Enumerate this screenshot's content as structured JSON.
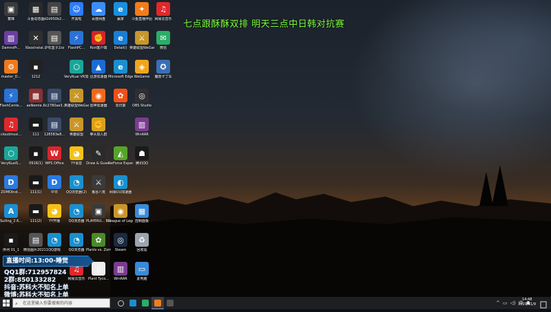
{
  "overlay_title": "七点跟酥酥双排 明天三点中日韩对抗赛",
  "icons": [
    {
      "label": "蓄降",
      "color": "#3a3a3a",
      "glyph": "▣",
      "col": 0,
      "row": 0
    },
    {
      "label": "斗鱼动态图",
      "color": "#2a2a2a",
      "glyph": "▦",
      "col": 1,
      "row": 0
    },
    {
      "label": "d2d950b2...",
      "color": "#444444",
      "glyph": "▤",
      "col": 2,
      "row": 0
    },
    {
      "label": "开黑啦",
      "color": "#2e7cf6",
      "glyph": "☺",
      "col": 3,
      "row": 0
    },
    {
      "label": "百度网盘",
      "color": "#3d8df5",
      "glyph": "☁",
      "col": 4,
      "row": 0
    },
    {
      "label": "赢家",
      "color": "#1a8fe0",
      "glyph": "e",
      "col": 5,
      "row": 0
    },
    {
      "label": "斗鱼直播伴侣",
      "color": "#f07d1a",
      "glyph": "✦",
      "col": 6,
      "row": 0
    },
    {
      "label": "网易云音乐",
      "color": "#e0282b",
      "glyph": "♫",
      "col": 7,
      "row": 0
    },
    {
      "label": "DamnsPr...",
      "color": "#6b3fa0",
      "glyph": "▥",
      "col": 0,
      "row": 1
    },
    {
      "label": "XboxInstal...",
      "color": "#2f2f2f",
      "glyph": "✕",
      "col": 1,
      "row": 1
    },
    {
      "label": "炉石盒子2zz",
      "color": "#555555",
      "glyph": "▤",
      "col": 2,
      "row": 1
    },
    {
      "label": "FlashPC...",
      "color": "#2a72d6",
      "glyph": "⚡",
      "col": 3,
      "row": 1
    },
    {
      "label": "Riot客户端",
      "color": "#d5242a",
      "glyph": "✊",
      "col": 4,
      "row": 1
    },
    {
      "label": "Detail()",
      "color": "#1a7fd4",
      "glyph": "e",
      "col": 5,
      "row": 1
    },
    {
      "label": "英雄联盟WeGame版",
      "color": "#c8962a",
      "glyph": "⚔",
      "col": 6,
      "row": 1
    },
    {
      "label": "微信",
      "color": "#2aae67",
      "glyph": "✉",
      "col": 7,
      "row": 1
    },
    {
      "label": "master_D...",
      "color": "#ee7a1c",
      "glyph": "⚙",
      "col": 0,
      "row": 2
    },
    {
      "label": "1212",
      "color": "#222222",
      "glyph": "▪",
      "col": 1,
      "row": 2
    },
    {
      "label": "VeryKuai VR加速器",
      "color": "#1aa69a",
      "glyph": "⬡",
      "col": 3,
      "row": 2
    },
    {
      "label": "迅游加速器",
      "color": "#1c6bd6",
      "glyph": "▲",
      "col": 4,
      "row": 2
    },
    {
      "label": "Microsoft Edge",
      "color": "#1b8fce",
      "glyph": "e",
      "col": 5,
      "row": 2
    },
    {
      "label": "WeGame",
      "color": "#f0a51f",
      "glyph": "◈",
      "col": 6,
      "row": 2
    },
    {
      "label": "魔兽卡丁车",
      "color": "#3b6fb5",
      "glyph": "✪",
      "col": 7,
      "row": 2
    },
    {
      "label": "FlashCente...",
      "color": "#2a72d6",
      "glyph": "⚡",
      "col": 0,
      "row": 3
    },
    {
      "label": "aeNemie...",
      "color": "#8a3030",
      "glyph": "▩",
      "col": 1,
      "row": 3
    },
    {
      "label": "6c2780ae3...",
      "color": "#3a4a6a",
      "glyph": "▤",
      "col": 2,
      "row": 3
    },
    {
      "label": "英雄联盟WeGame版",
      "color": "#c8962a",
      "glyph": "⚔",
      "col": 3,
      "row": 3
    },
    {
      "label": "雷神加速器",
      "color": "#f0681a",
      "glyph": "◉",
      "col": 4,
      "row": 3
    },
    {
      "label": "向日葵",
      "color": "#f0501a",
      "glyph": "✿",
      "col": 5,
      "row": 3
    },
    {
      "label": "OBS Studio",
      "color": "#302e31",
      "glyph": "◎",
      "col": 6,
      "row": 3
    },
    {
      "label": "cloudmusi...",
      "color": "#e0282b",
      "glyph": "♫",
      "col": 0,
      "row": 4
    },
    {
      "label": "111",
      "color": "#1a1a1a",
      "glyph": "▬",
      "col": 1,
      "row": 4
    },
    {
      "label": "128583e8...",
      "color": "#3a4a6a",
      "glyph": "▤",
      "col": 2,
      "row": 4
    },
    {
      "label": "英雄联盟",
      "color": "#c8962a",
      "glyph": "⚔",
      "col": 3,
      "row": 4
    },
    {
      "label": "拳头加入群",
      "color": "#d8a020",
      "glyph": "✊",
      "col": 4,
      "row": 4
    },
    {
      "label": "WinRAR",
      "color": "#7a3c8e",
      "glyph": "▥",
      "col": 6,
      "row": 4
    },
    {
      "label": "VeryKuaiS...",
      "color": "#1aa69a",
      "glyph": "⬡",
      "col": 0,
      "row": 5
    },
    {
      "label": "0916(1)",
      "color": "#1a1a1a",
      "glyph": "▪",
      "col": 1,
      "row": 5
    },
    {
      "label": "WPS Office",
      "color": "#d6262a",
      "glyph": "W",
      "col": 2,
      "row": 5
    },
    {
      "label": "YY语音",
      "color": "#f2c21a",
      "glyph": "◕",
      "col": 3,
      "row": 5
    },
    {
      "label": "Draw & Guess",
      "color": "#2a2a2a",
      "glyph": "✎",
      "col": 4,
      "row": 5
    },
    {
      "label": "GeForce Experience",
      "color": "#56a52a",
      "glyph": "◭",
      "col": 5,
      "row": 5
    },
    {
      "label": "腾讯QQ",
      "color": "#1a1a1a",
      "glyph": "☗",
      "col": 6,
      "row": 5
    },
    {
      "label": "ZOMOInst...",
      "color": "#2a7ae0",
      "glyph": "D",
      "col": 0,
      "row": 6
    },
    {
      "label": "111(1)",
      "color": "#1a1a1a",
      "glyph": "▬",
      "col": 1,
      "row": 6
    },
    {
      "label": "中日",
      "color": "#2a7ae0",
      "glyph": "D",
      "col": 2,
      "row": 6
    },
    {
      "label": "QQ浏览器(2)",
      "color": "#1b8fce",
      "glyph": "◔",
      "col": 3,
      "row": 6
    },
    {
      "label": "鬼谷八荒",
      "color": "#3a3a3a",
      "glyph": "⚔",
      "col": 4,
      "row": 6
    },
    {
      "label": "网易UU加速器",
      "color": "#1b8fce",
      "glyph": "◐",
      "col": 5,
      "row": 6
    },
    {
      "label": "Suiling_2.6...",
      "color": "#1a8fd4",
      "glyph": "A",
      "col": 0,
      "row": 7
    },
    {
      "label": "111(2)",
      "color": "#1a1a1a",
      "glyph": "▬",
      "col": 1,
      "row": 7
    },
    {
      "label": "YY开播",
      "color": "#f2c21a",
      "glyph": "◕",
      "col": 2,
      "row": 7
    },
    {
      "label": "QQ浏览器",
      "color": "#1b8fce",
      "glyph": "◔",
      "col": 3,
      "row": 7
    },
    {
      "label": "PLAYERU... BATTLEGR...",
      "color": "#3a3a3a",
      "glyph": "▣",
      "col": 4,
      "row": 7
    },
    {
      "label": "League of Legends",
      "color": "#c8962a",
      "glyph": "◉",
      "col": 5,
      "row": 7
    },
    {
      "label": "控制面板",
      "color": "#3a8ad6",
      "glyph": "▦",
      "col": 6,
      "row": 7
    },
    {
      "label": "序列 01_1",
      "color": "#1a1a1a",
      "glyph": "▪",
      "col": 0,
      "row": 8
    },
    {
      "label": "微信图片20211...",
      "color": "#555555",
      "glyph": "▤",
      "col": 1,
      "row": 8
    },
    {
      "label": "QQ游戏",
      "color": "#1b8fce",
      "glyph": "◔",
      "col": 2,
      "row": 8
    },
    {
      "label": "QQ浏览器",
      "color": "#1b8fce",
      "glyph": "◔",
      "col": 3,
      "row": 8
    },
    {
      "label": "Plants vs. Zombies G...",
      "color": "#4a8a2a",
      "glyph": "✿",
      "col": 4,
      "row": 8
    },
    {
      "label": "Steam",
      "color": "#1b2a3e",
      "glyph": "◎",
      "col": 5,
      "row": 8
    },
    {
      "label": "回收站",
      "color": "#9aa5b0",
      "glyph": "♻",
      "col": 6,
      "row": 8
    },
    {
      "label": "网易云音乐",
      "color": "#e0282b",
      "glyph": "♫",
      "col": 3,
      "row": 9
    },
    {
      "label": "Plant Tyco...",
      "color": "#eeeeee",
      "glyph": "▯",
      "col": 4,
      "row": 9
    },
    {
      "label": "WinRAR",
      "color": "#7a3c8e",
      "glyph": "▥",
      "col": 5,
      "row": 9
    },
    {
      "label": "此电脑",
      "color": "#3a8ad6",
      "glyph": "▭",
      "col": 6,
      "row": 9
    }
  ],
  "stream_panel": {
    "time": "直播时间:13:00-睡觉",
    "qq1": "QQ1群:712957824",
    "qq2": "2群:850133282",
    "douyin": "抖音:苏科大不知名上单",
    "weibo": "微博:苏科大不知名上单"
  },
  "taskbar": {
    "search_placeholder": "在这里输入你要搜索的内容",
    "clock_time": "14:48",
    "clock_date": "2021/11/9",
    "ime": "中",
    "apps": [
      {
        "name": "task-view",
        "color": "#cccccc"
      },
      {
        "name": "edge",
        "color": "#1b8fce"
      },
      {
        "name": "wechat",
        "color": "#2aae67"
      },
      {
        "name": "douyu",
        "color": "#f07d1a"
      },
      {
        "name": "obs",
        "color": "#555555"
      }
    ]
  }
}
